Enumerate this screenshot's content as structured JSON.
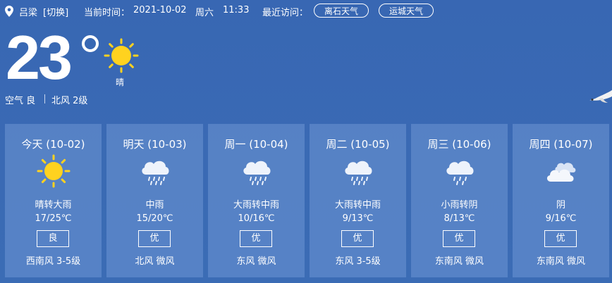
{
  "header": {
    "city": "吕梁",
    "switch_label": "[切换]",
    "current_time_label": "当前时间：",
    "date": "2021-10-02",
    "weekday": "周六",
    "time": "11:33",
    "recent_label": "最近访问：",
    "recent": [
      "离石天气",
      "运城天气"
    ]
  },
  "current": {
    "temperature": "23",
    "condition": "晴",
    "air": "空气 良",
    "wind": "北风 2级",
    "icon": "sun-icon"
  },
  "forecast": [
    {
      "day": "今天 (10-02)",
      "icon": "sun-icon",
      "condition": "晴转大雨",
      "temp": "17/25℃",
      "aqi": "良",
      "wind": "西南风 3-5级"
    },
    {
      "day": "明天 (10-03)",
      "icon": "rain-icon",
      "condition": "中雨",
      "temp": "15/20℃",
      "aqi": "优",
      "wind": "北风 微风"
    },
    {
      "day": "周一 (10-04)",
      "icon": "rain-icon",
      "condition": "大雨转中雨",
      "temp": "10/16℃",
      "aqi": "优",
      "wind": "东风 微风"
    },
    {
      "day": "周二 (10-05)",
      "icon": "rain-icon",
      "condition": "大雨转中雨",
      "temp": "9/13℃",
      "aqi": "优",
      "wind": "东风 3-5级"
    },
    {
      "day": "周三 (10-06)",
      "icon": "rain-icon",
      "condition": "小雨转阴",
      "temp": "8/13℃",
      "aqi": "优",
      "wind": "东南风 微风"
    },
    {
      "day": "周四 (10-07)",
      "icon": "cloud-icon",
      "condition": "阴",
      "temp": "9/16℃",
      "aqi": "优",
      "wind": "东南风 微风"
    }
  ],
  "colors": {
    "background": "#3a6ab4",
    "card": "#6e96d4",
    "sun": "#ffd21f",
    "cloud": "#eef3fb"
  }
}
